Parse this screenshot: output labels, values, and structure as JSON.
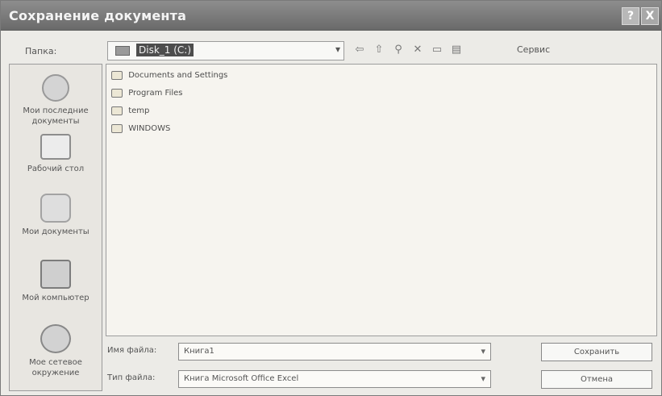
{
  "window": {
    "title": "Сохранение документа",
    "help_icon": "?",
    "close_icon": "X"
  },
  "toolbar": {
    "folder_label": "Папка:",
    "current_folder": "Disk_1 (C:)",
    "combo_arrow": "▾",
    "tools_label": "Сервис",
    "icons": [
      "back-icon",
      "up-folder-icon",
      "search-web-icon",
      "delete-icon",
      "new-folder-icon",
      "views-icon",
      "tools-icon"
    ]
  },
  "places": [
    {
      "label": "Мои последние документы"
    },
    {
      "label": "Рабочий стол"
    },
    {
      "label": "Мои документы"
    },
    {
      "label": "Мой компьютер"
    },
    {
      "label": "Мое сетевое окружение"
    }
  ],
  "files": [
    {
      "name": "Documents and Settings"
    },
    {
      "name": "Program Files"
    },
    {
      "name": "temp"
    },
    {
      "name": "WINDOWS"
    }
  ],
  "form": {
    "filename_label": "Имя файла:",
    "filename_value": "Книга1",
    "filetype_label": "Тип файла:",
    "filetype_value": "Книга Microsoft Office Excel",
    "arrow": "▾"
  },
  "buttons": {
    "save": "Сохранить",
    "cancel": "Отмена"
  }
}
